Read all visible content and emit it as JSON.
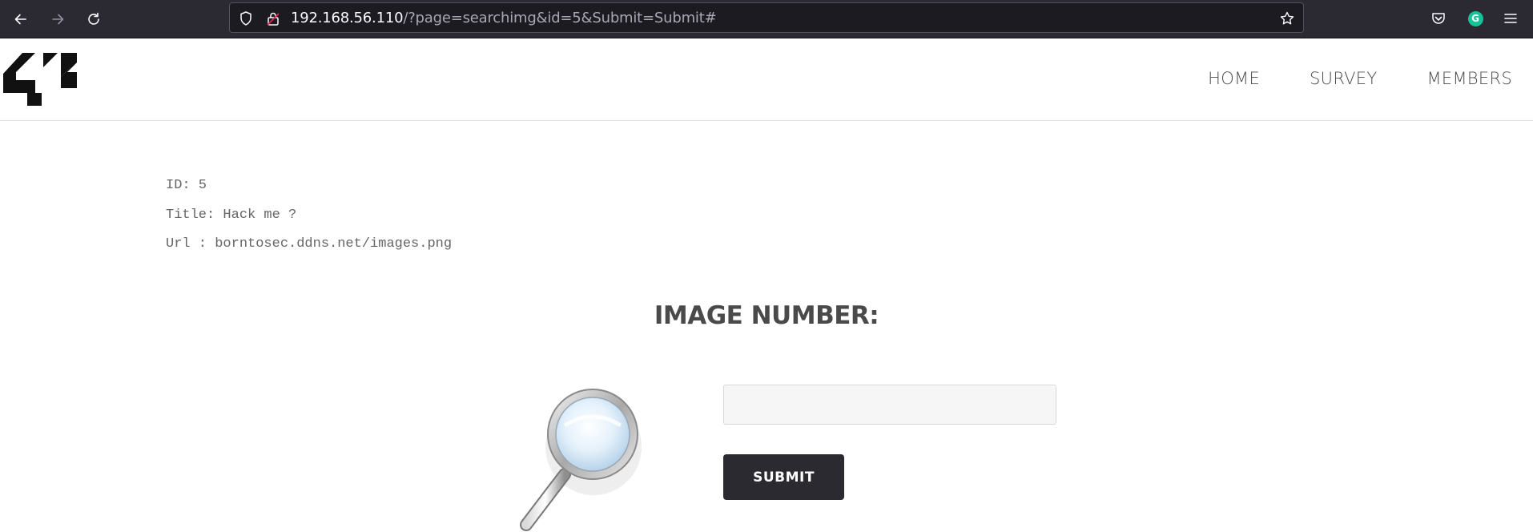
{
  "browser": {
    "url_host": "192.168.56.110",
    "url_rest": "/?page=searchimg&id=5&Submit=Submit#",
    "extension_letter": "G",
    "icons": [
      "back-icon",
      "forward-icon",
      "reload-icon",
      "shield-icon",
      "lock-icon",
      "star-icon",
      "pocket-icon",
      "grammarly-icon",
      "menu-icon"
    ],
    "colors": {
      "chrome": "#2b2a33",
      "urlbar": "#1c1b22",
      "grammarly": "#15c39a"
    }
  },
  "site": {
    "logo": "42",
    "nav": {
      "home": "HOME",
      "survey": "SURVEY",
      "members": "MEMBERS"
    }
  },
  "record": {
    "id_line": "ID: 5",
    "title_line": "Title: Hack me ?",
    "url_line": "Url : borntosec.ddns.net/images.png"
  },
  "search": {
    "heading": "IMAGE NUMBER:",
    "input_value": "",
    "submit_label": "SUBMIT",
    "icon": "magnifier-icon"
  }
}
